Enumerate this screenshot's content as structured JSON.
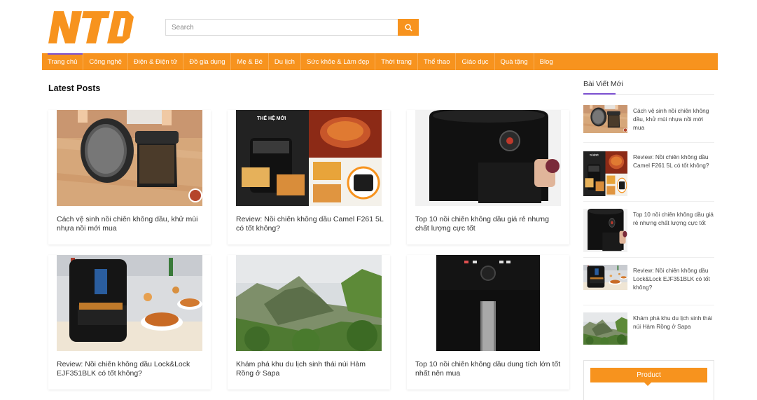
{
  "brand": {
    "logo_text": "NTD",
    "accent_color": "#f7931e",
    "highlight_color": "#7b4fcf"
  },
  "search": {
    "placeholder": "Search",
    "icon": "search-icon"
  },
  "nav": {
    "items": [
      {
        "label": "Trang chủ",
        "active": true
      },
      {
        "label": "Công nghệ"
      },
      {
        "label": "Điện & Điện tử"
      },
      {
        "label": "Đồ gia dụng"
      },
      {
        "label": "Mẹ & Bé"
      },
      {
        "label": "Du lịch"
      },
      {
        "label": "Sức khỏe & Làm đẹp"
      },
      {
        "label": "Thời trang"
      },
      {
        "label": "Thể thao"
      },
      {
        "label": "Giáo dục"
      },
      {
        "label": "Quà tặng"
      },
      {
        "label": "Blog"
      }
    ]
  },
  "main": {
    "section_title": "Latest Posts",
    "posts": [
      {
        "title": "Cách vệ sinh nồi chiên không dầu, khử mùi nhựa nồi mới mua",
        "image": "air-fryer-basket-photo"
      },
      {
        "title": "Review: Nồi chiên không dầu Camel F261 5L có tốt không?",
        "image": "air-fryer-collage-photo",
        "image_banner_text": "THẾ HỆ MỚI"
      },
      {
        "title": "Top 10 nồi chiên không dầu giá rẻ nhưng chất lượng cực tốt",
        "image": "black-air-fryer-photo"
      },
      {
        "title": "Review: Nồi chiên không dầu Lock&Lock EJF351BLK có tốt không?",
        "image": "air-fryer-chicken-photo"
      },
      {
        "title": "Khám phá khu du lịch sinh thái núi Hàm Rồng ở Sapa",
        "image": "mountain-landscape-photo"
      },
      {
        "title": "Top 10 nồi chiên không dầu dung tích lớn tốt nhất nên mua",
        "image": "large-air-fryer-photo"
      }
    ]
  },
  "sidebar": {
    "title": "Bài Viết Mới",
    "items": [
      {
        "title": "Cách vệ sinh nồi chiên không dầu, khử mùi nhựa nồi mới mua"
      },
      {
        "title": "Review: Nồi chiên không dầu Camel F261 5L có tốt không?"
      },
      {
        "title": "Top 10 nồi chiên không dầu giá rẻ nhưng chất lượng cực tốt"
      },
      {
        "title": "Review: Nồi chiên không dầu Lock&Lock EJF351BLK có tốt không?"
      },
      {
        "title": "Khám phá khu du lịch sinh thái núi Hàm Rồng ở Sapa"
      }
    ],
    "product_label": "Product"
  }
}
